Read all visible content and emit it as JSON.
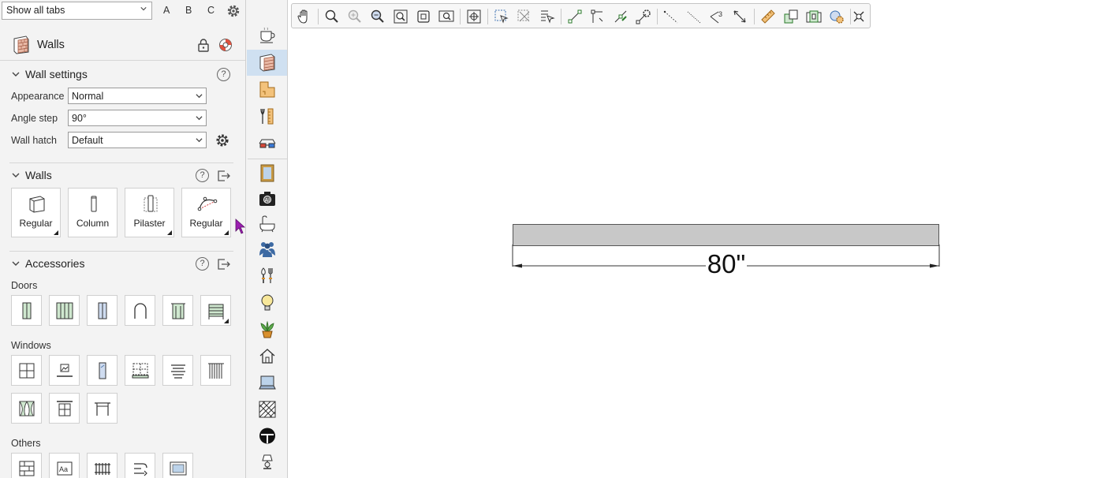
{
  "topbar": {
    "tab_select_value": "Show all tabs",
    "letter_tabs": [
      "A",
      "B",
      "C"
    ]
  },
  "panel": {
    "title": "Walls",
    "wall_settings": {
      "heading": "Wall settings",
      "fields": [
        {
          "label": "Appearance",
          "value": "Normal"
        },
        {
          "label": "Angle step",
          "value": "90°"
        },
        {
          "label": "Wall hatch",
          "value": "Default"
        }
      ]
    },
    "walls": {
      "heading": "Walls",
      "tools": [
        "Regular",
        "Column",
        "Pilaster",
        "Regular"
      ]
    },
    "accessories": {
      "heading": "Accessories",
      "doors_label": "Doors",
      "windows_label": "Windows",
      "others_label": "Others"
    },
    "help_glyph": "?"
  },
  "canvas": {
    "dimension_label": "80\""
  },
  "colors": {
    "panel_bg": "#f3f3f3",
    "active_strip": "#cfe0f1",
    "wall_fill": "#c8c8c8",
    "cursor": "#9b1fb0"
  }
}
